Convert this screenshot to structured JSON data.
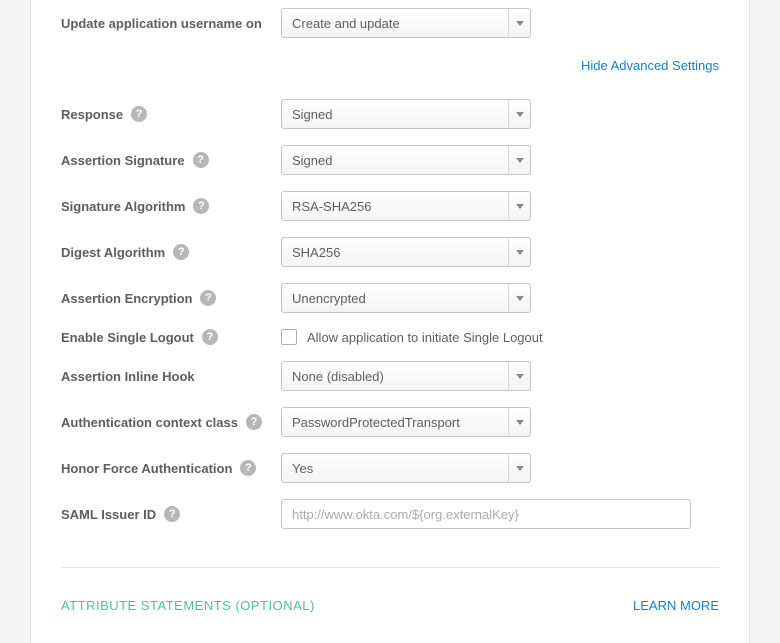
{
  "fields": {
    "update_username_on": {
      "label": "Update application username on",
      "value": "Create and update"
    },
    "response": {
      "label": "Response",
      "value": "Signed"
    },
    "assertion_signature": {
      "label": "Assertion Signature",
      "value": "Signed"
    },
    "signature_algorithm": {
      "label": "Signature Algorithm",
      "value": "RSA-SHA256"
    },
    "digest_algorithm": {
      "label": "Digest Algorithm",
      "value": "SHA256"
    },
    "assertion_encryption": {
      "label": "Assertion Encryption",
      "value": "Unencrypted"
    },
    "enable_single_logout": {
      "label": "Enable Single Logout",
      "checkbox_label": "Allow application to initiate Single Logout"
    },
    "assertion_inline_hook": {
      "label": "Assertion Inline Hook",
      "value": "None (disabled)"
    },
    "auth_context_class": {
      "label": "Authentication context class",
      "value": "PasswordProtectedTransport"
    },
    "honor_force_auth": {
      "label": "Honor Force Authentication",
      "value": "Yes"
    },
    "saml_issuer_id": {
      "label": "SAML Issuer ID",
      "placeholder": "http://www.okta.com/${org.externalKey}"
    }
  },
  "links": {
    "hide_advanced": "Hide Advanced Settings",
    "learn_more": "LEARN MORE"
  },
  "section": {
    "attribute_statements": "ATTRIBUTE STATEMENTS (OPTIONAL)"
  },
  "help_glyph": "?"
}
